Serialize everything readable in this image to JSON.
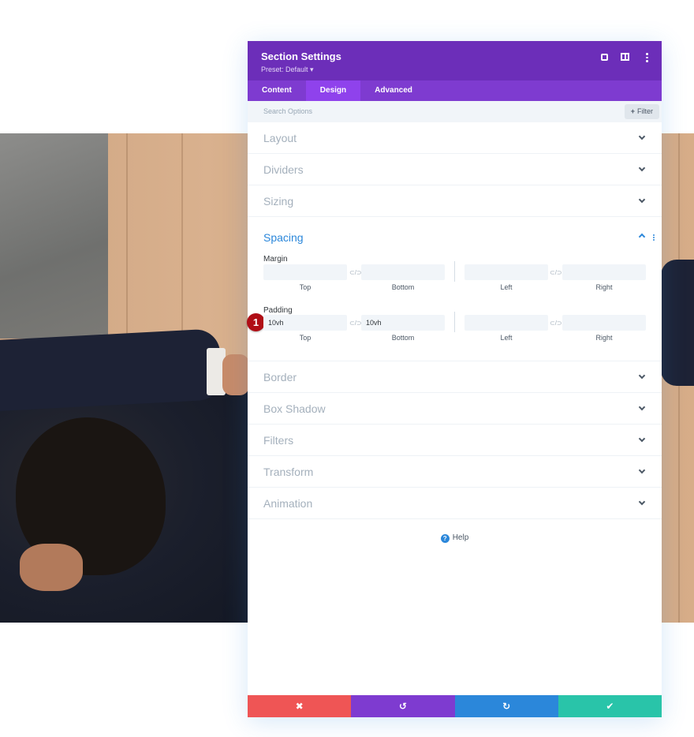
{
  "panel": {
    "title": "Section Settings",
    "preset": "Preset: Default ▾"
  },
  "header_icons": [
    "expand-icon",
    "split-view-icon",
    "more-options-icon"
  ],
  "tabs": [
    {
      "label": "Content",
      "active": false
    },
    {
      "label": "Design",
      "active": true
    },
    {
      "label": "Advanced",
      "active": false
    }
  ],
  "search": {
    "placeholder": "Search Options",
    "filter_label": "Filter",
    "filter_icon": "+"
  },
  "groups_before": [
    {
      "label": "Layout"
    },
    {
      "label": "Dividers"
    },
    {
      "label": "Sizing"
    }
  ],
  "spacing": {
    "title": "Spacing",
    "margin": {
      "label": "Margin",
      "top": {
        "value": "",
        "caption": "Top"
      },
      "bottom": {
        "value": "",
        "caption": "Bottom"
      },
      "left": {
        "value": "",
        "caption": "Left"
      },
      "right": {
        "value": "",
        "caption": "Right"
      }
    },
    "padding": {
      "label": "Padding",
      "top": {
        "value": "10vh",
        "caption": "Top"
      },
      "bottom": {
        "value": "10vh",
        "caption": "Bottom"
      },
      "left": {
        "value": "",
        "caption": "Left"
      },
      "right": {
        "value": "",
        "caption": "Right"
      }
    },
    "link_icon": "⊂/⊃",
    "step_badge": "1"
  },
  "groups_after": [
    {
      "label": "Border"
    },
    {
      "label": "Box Shadow"
    },
    {
      "label": "Filters"
    },
    {
      "label": "Transform"
    },
    {
      "label": "Animation"
    }
  ],
  "help": {
    "label": "Help",
    "icon": "?"
  },
  "footer": {
    "cancel_icon": "✖",
    "undo_icon": "↺",
    "redo_icon": "↻",
    "save_icon": "✔"
  },
  "colors": {
    "header": "#6c2eb9",
    "tabs": "#7e3bd0",
    "active_tab": "#8f42ec",
    "accent_blue": "#2b87da",
    "cancel": "#ef5555",
    "save": "#29c4a9",
    "badge": "#b00e16"
  }
}
